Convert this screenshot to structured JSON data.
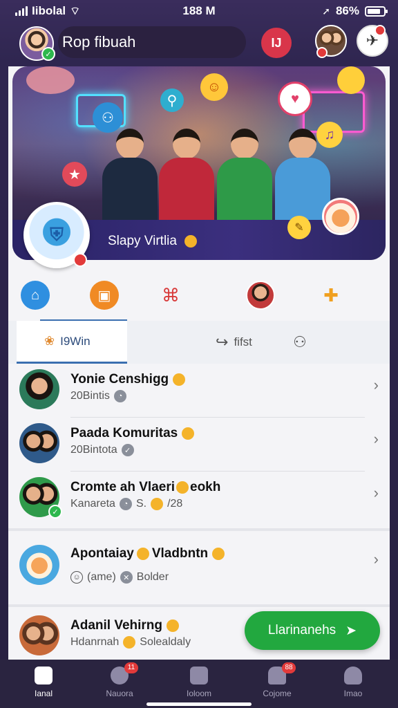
{
  "status_bar": {
    "carrier": "Iibolal",
    "time": "188 M",
    "battery": "86%"
  },
  "header": {
    "title": "Rop fibuah",
    "red_button_label": "IJ"
  },
  "banner": {
    "community_name": "Slapy Virtlia"
  },
  "tabs": {
    "active_label": "I9Win",
    "share_label": "fifst"
  },
  "list": [
    {
      "name": "Yonie Censhigg",
      "sub": "20Bintis"
    },
    {
      "name": "Paada Komuritas",
      "sub": "20Bintota"
    },
    {
      "name": "Cromte ah Vlaeri",
      "name_tail": "eokh",
      "sub": "Kanareta",
      "sub_tail": "S. ",
      "sub_tail2": "/28"
    },
    {
      "name": "Apontaiay",
      "name_mid": "Vladbntn",
      "sub": "(ame)",
      "sub_tail": "Bolder"
    },
    {
      "name": "Adanil Vehirng",
      "sub": "Hdanrnah",
      "sub_tail": "Solealdaly"
    }
  ],
  "cta": {
    "label": "Llarinanehs"
  },
  "bottom_nav": [
    {
      "label": "Ianal",
      "badge": ""
    },
    {
      "label": "Nauora",
      "badge": "11"
    },
    {
      "label": "Ioloom",
      "badge": ""
    },
    {
      "label": "Cojome",
      "badge": "88"
    },
    {
      "label": "Imao",
      "badge": ""
    }
  ]
}
